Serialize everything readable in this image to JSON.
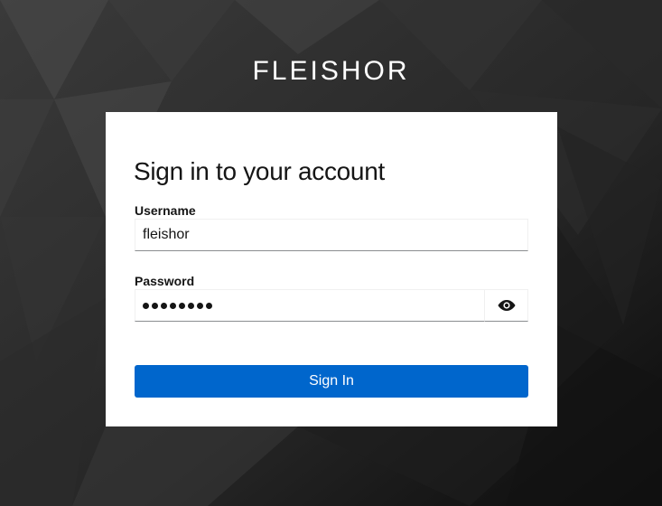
{
  "brand": {
    "name": "FLEISHOR"
  },
  "login": {
    "title": "Sign in to your account",
    "username_label": "Username",
    "username_value": "fleishor",
    "password_label": "Password",
    "password_masked_length": 8,
    "signin_label": "Sign In"
  },
  "icons": {
    "toggle_password": "eye-icon"
  },
  "colors": {
    "primary": "#0066cc",
    "card_bg": "#ffffff",
    "text": "#151515"
  }
}
